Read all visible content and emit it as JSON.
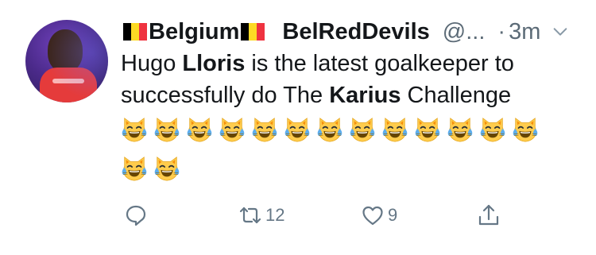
{
  "tweet": {
    "author": {
      "display_name": "Belgium",
      "username": "BelRedDevils",
      "handle_truncated": "@..."
    },
    "separator": "·",
    "timestamp": "3m",
    "text": {
      "p1": "Hugo ",
      "b1": "Lloris",
      "p2": " is the latest goalkeeper to successfully do The ",
      "b2": "Karius",
      "p3": " Challenge"
    },
    "emoji": {
      "name": "face-with-tears-of-joy-cat",
      "row1_count": 13,
      "row2_count": 2
    },
    "actions": {
      "reply": {
        "icon": "reply-icon"
      },
      "retweet": {
        "icon": "retweet-icon",
        "count": "12"
      },
      "like": {
        "icon": "heart-icon",
        "count": "9"
      },
      "share": {
        "icon": "share-icon"
      }
    },
    "colors": {
      "text": "#14171a",
      "secondary": "#657786",
      "flag_black": "#000000",
      "flag_yellow": "#FDDA24",
      "flag_red": "#EF3340"
    }
  }
}
